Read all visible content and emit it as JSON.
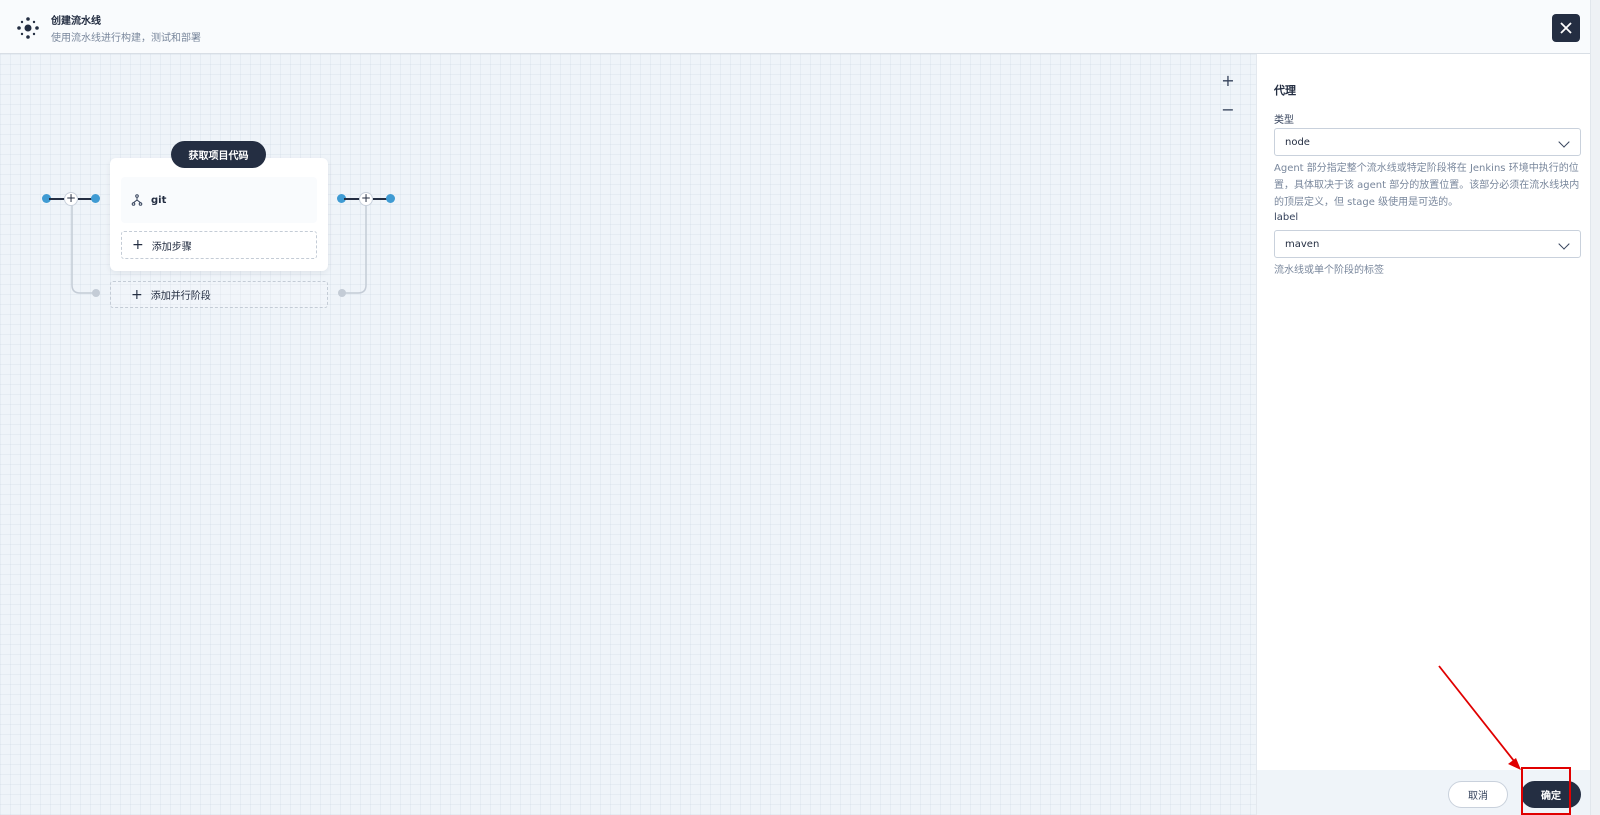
{
  "header": {
    "title": "创建流水线",
    "subtitle": "使用流水线进行构建，测试和部署",
    "logo_icon": "pipeline-icon",
    "close_icon": "close-icon"
  },
  "canvas": {
    "zoom_in": "+",
    "zoom_out": "−",
    "stage": {
      "title": "获取项目代码",
      "steps": [
        {
          "label": "git",
          "icon": "git-branch-icon"
        }
      ],
      "add_step_label": "添加步骤"
    },
    "add_parallel_label": "添加并行阶段"
  },
  "panel": {
    "section_title": "代理",
    "type_label": "类型",
    "type_value": "node",
    "type_desc": "Agent 部分指定整个流水线或特定阶段将在 Jenkins 环境中执行的位置，具体取决于该 agent 部分的放置位置。该部分必须在流水线块内的顶层定义，但 stage 级使用是可选的。",
    "label_label": "label",
    "label_value": "maven",
    "label_desc": "流水线或单个阶段的标签",
    "cancel_label": "取消",
    "ok_label": "确定"
  },
  "colors": {
    "primary": "#242e42",
    "accent": "#3f9bd3",
    "annotation": "#e00000"
  }
}
